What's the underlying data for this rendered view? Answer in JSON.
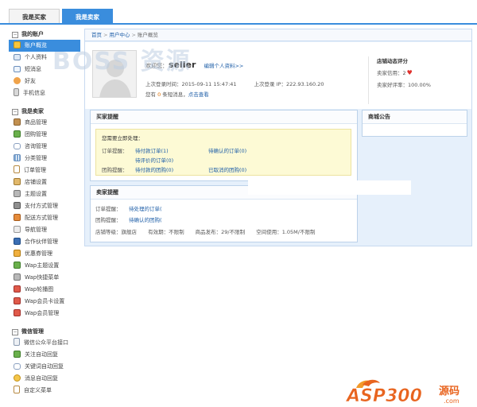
{
  "tabs": {
    "buyer": "我是买家",
    "seller": "我是卖家"
  },
  "sidebar": {
    "sections": [
      {
        "title": "我的账户",
        "items": [
          {
            "label": "账户概览",
            "icon": "home-icon",
            "active": true
          },
          {
            "label": "个人资料",
            "icon": "id-card-icon"
          },
          {
            "label": "短消息",
            "icon": "mail-icon"
          },
          {
            "label": "好友",
            "icon": "friends-icon"
          },
          {
            "label": "手机信息",
            "icon": "phone-icon"
          }
        ]
      },
      {
        "title": "我是卖家",
        "items": [
          {
            "label": "商品管理",
            "icon": "box-icon"
          },
          {
            "label": "团购管理",
            "icon": "group-buy-icon"
          },
          {
            "label": "咨询管理",
            "icon": "chat-icon"
          },
          {
            "label": "分类管理",
            "icon": "category-icon"
          },
          {
            "label": "订单管理",
            "icon": "order-icon"
          },
          {
            "label": "店铺设置",
            "icon": "shop-icon"
          },
          {
            "label": "主题设置",
            "icon": "theme-icon"
          },
          {
            "label": "支付方式管理",
            "icon": "payment-icon"
          },
          {
            "label": "配送方式管理",
            "icon": "delivery-icon"
          },
          {
            "label": "导航管理",
            "icon": "navigation-icon"
          },
          {
            "label": "合作伙伴管理",
            "icon": "partner-icon"
          },
          {
            "label": "优惠券管理",
            "icon": "coupon-icon"
          },
          {
            "label": "Wap主题设置",
            "icon": "wap-theme-icon"
          },
          {
            "label": "Wap快捷菜单",
            "icon": "wap-menu-icon"
          },
          {
            "label": "Wap轮播图",
            "icon": "wap-slider-icon"
          },
          {
            "label": "Wap会员卡设置",
            "icon": "wap-card-icon"
          },
          {
            "label": "Wap会员管理",
            "icon": "wap-member-icon"
          }
        ]
      },
      {
        "title": "微信管理",
        "items": [
          {
            "label": "微信公众平台接口",
            "icon": "wechat-api-icon"
          },
          {
            "label": "关注自动回复",
            "icon": "follow-reply-icon"
          },
          {
            "label": "关键词自动回复",
            "icon": "keyword-reply-icon"
          },
          {
            "label": "消息自动回复",
            "icon": "message-reply-icon"
          },
          {
            "label": "自定义菜单",
            "icon": "custom-menu-icon"
          }
        ]
      }
    ]
  },
  "breadcrumb": {
    "home": "首页",
    "center": "用户中心",
    "current": "账户概览",
    "sep": ">"
  },
  "profile": {
    "welcome": "欢迎您：",
    "username": "seller",
    "edit_link": "编辑个人资料>>",
    "last_login_time": "上次登录时间：2015-09-11 15:47:41",
    "last_login_ip": "上次登录 IP：222.93.160.20",
    "msg_prefix": "您有",
    "msg_count": "0",
    "msg_suffix": "条短消息，",
    "msg_link": "点击查看"
  },
  "rating": {
    "title": "店铺动态评分",
    "credit_label": "卖家信用：",
    "credit_value": "2",
    "good_rate": "卖家好评率：100.00%"
  },
  "buyer_reminder": {
    "title": "买家提醒",
    "lead": "您需要立即处理：",
    "order_label": "订单提醒：",
    "pending_payment": "待付款订单(1)",
    "pending_confirm": "待确认的订单(0)",
    "pending_review": "待评价的订单(0)",
    "groupbuy_label": "团购提醒：",
    "groupbuy_unpaid": "待付款的团购(0)",
    "groupbuy_cancelled": "已取消的团购(0)"
  },
  "mall_notice": {
    "title": "商城公告"
  },
  "seller_reminder": {
    "title": "卖家提醒",
    "order_label": "订单提醒：",
    "order_link": "待处理的订单(",
    "groupbuy_label": "团购提醒：",
    "groupbuy_link": "待确认的团购(",
    "shop_level": "店铺等级：旗舰店",
    "validity": "有效期：不限制",
    "products": "商品发布：29/不限制",
    "space": "空间使用：1.05M/不限制"
  },
  "watermarks": {
    "boss": "BOSS 资源",
    "asp": "ASP300",
    "asp_suffix": "源码",
    "asp_url": ".com"
  },
  "colors": {
    "accent": "#3a8ddd",
    "link": "#1f5fa8",
    "panel_bg": "#e6f0fb",
    "highlight_bg": "#fdfad5",
    "heart": "#e0302c"
  }
}
